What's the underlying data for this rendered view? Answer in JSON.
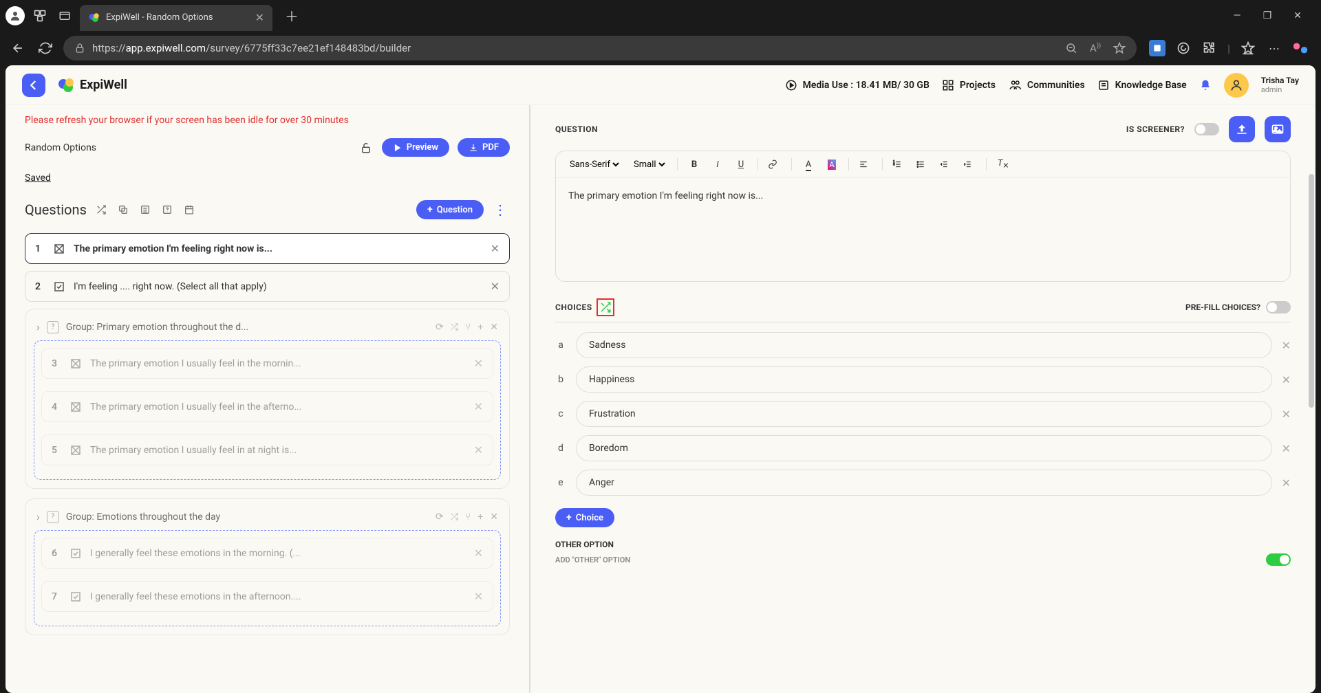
{
  "browser": {
    "tab_title": "ExpiWell - Random Options",
    "url_prefix": "https://",
    "url_domain": "app.expiwell.com",
    "url_path": "/survey/6775ff33c7ee21ef148483bd/builder"
  },
  "header": {
    "brand": "ExpiWell",
    "media_use": "Media Use : 18.41 MB/ 30 GB",
    "nav": {
      "projects": "Projects",
      "communities": "Communities",
      "kb": "Knowledge Base"
    },
    "user_name": "Trisha Tay",
    "user_role": "admin"
  },
  "left": {
    "warning": "Please refresh your browser if your screen has been idle for over 30 minutes",
    "survey_title": "Random Options",
    "preview_btn": "Preview",
    "pdf_btn": "PDF",
    "saved": "Saved",
    "questions_label": "Questions",
    "add_question_btn": "Question",
    "questions": [
      {
        "num": "1",
        "text": "The primary emotion I'm feeling right now is..."
      },
      {
        "num": "2",
        "text": "I'm feeling .... right now. (Select all that apply)"
      }
    ],
    "group1": {
      "title": "Group: Primary emotion throughout the d...",
      "items": [
        {
          "num": "3",
          "text": "The primary emotion I usually feel in the mornin..."
        },
        {
          "num": "4",
          "text": "The primary emotion I usually feel in the afterno..."
        },
        {
          "num": "5",
          "text": "The primary emotion I usually feel in at night is..."
        }
      ]
    },
    "group2": {
      "title": "Group: Emotions throughout the day",
      "items": [
        {
          "num": "6",
          "text": "I generally feel these emotions in the morning. (..."
        },
        {
          "num": "7",
          "text": "I generally feel these emotions in the afternoon...."
        }
      ]
    }
  },
  "right": {
    "question_label": "QUESTION",
    "is_screener": "IS SCREENER?",
    "font_family": "Sans-Serif",
    "font_size": "Small",
    "question_text": "The primary emotion I'm feeling right now is...",
    "choices_label": "CHOICES",
    "prefill_label": "PRE-FILL CHOICES?",
    "choices": [
      {
        "letter": "a",
        "text": "Sadness"
      },
      {
        "letter": "b",
        "text": "Happiness"
      },
      {
        "letter": "c",
        "text": "Frustration"
      },
      {
        "letter": "d",
        "text": "Boredom"
      },
      {
        "letter": "e",
        "text": "Anger"
      }
    ],
    "add_choice_btn": "Choice",
    "other_label": "OTHER OPTION",
    "other_sub": "ADD \"OTHER\" OPTION"
  }
}
